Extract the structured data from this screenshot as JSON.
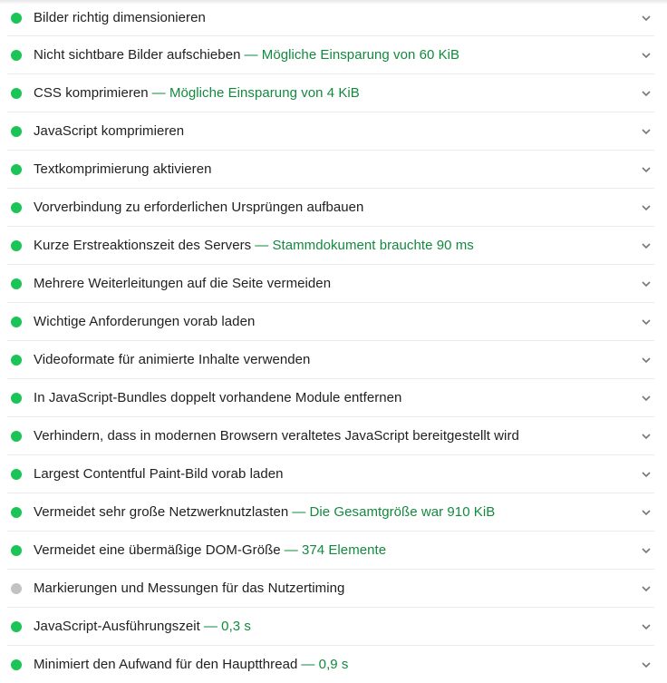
{
  "audits": [
    {
      "title": "Bilder richtig dimensionieren",
      "display": "",
      "status": "pass"
    },
    {
      "title": "Nicht sichtbare Bilder aufschieben",
      "display": "Mögliche Einsparung von 60 KiB",
      "status": "pass"
    },
    {
      "title": "CSS komprimieren",
      "display": "Mögliche Einsparung von 4 KiB",
      "status": "pass"
    },
    {
      "title": "JavaScript komprimieren",
      "display": "",
      "status": "pass"
    },
    {
      "title": "Textkomprimierung aktivieren",
      "display": "",
      "status": "pass"
    },
    {
      "title": "Vorverbindung zu erforderlichen Ursprüngen aufbauen",
      "display": "",
      "status": "pass"
    },
    {
      "title": "Kurze Erstreaktionszeit des Servers",
      "display": "Stammdokument brauchte 90 ms",
      "status": "pass"
    },
    {
      "title": "Mehrere Weiterleitungen auf die Seite vermeiden",
      "display": "",
      "status": "pass"
    },
    {
      "title": "Wichtige Anforderungen vorab laden",
      "display": "",
      "status": "pass"
    },
    {
      "title": "Videoformate für animierte Inhalte verwenden",
      "display": "",
      "status": "pass"
    },
    {
      "title": "In JavaScript-Bundles doppelt vorhandene Module entfernen",
      "display": "",
      "status": "pass"
    },
    {
      "title": "Verhindern, dass in modernen Browsern veraltetes JavaScript bereitgestellt wird",
      "display": "",
      "status": "pass"
    },
    {
      "title": "Largest Contentful Paint-Bild vorab laden",
      "display": "",
      "status": "pass"
    },
    {
      "title": "Vermeidet sehr große Netzwerknutzlasten",
      "display": "Die Gesamtgröße war 910 KiB",
      "status": "pass"
    },
    {
      "title": "Vermeidet eine übermäßige DOM-Größe",
      "display": "374 Elemente",
      "status": "pass"
    },
    {
      "title": "Markierungen und Messungen für das Nutzertiming",
      "display": "",
      "status": "informative"
    },
    {
      "title": "JavaScript-Ausführungszeit",
      "display": "0,3 s",
      "status": "pass"
    },
    {
      "title": "Minimiert den Aufwand für den Hauptthread",
      "display": "0,9 s",
      "status": "pass"
    }
  ],
  "colors": {
    "pass": "#1bc457",
    "informative": "#c2c2c2",
    "display_text": "#128a3e",
    "title_text": "#212121"
  },
  "icons": {
    "status": "status-dot-icon",
    "expand": "chevron-down-icon"
  }
}
